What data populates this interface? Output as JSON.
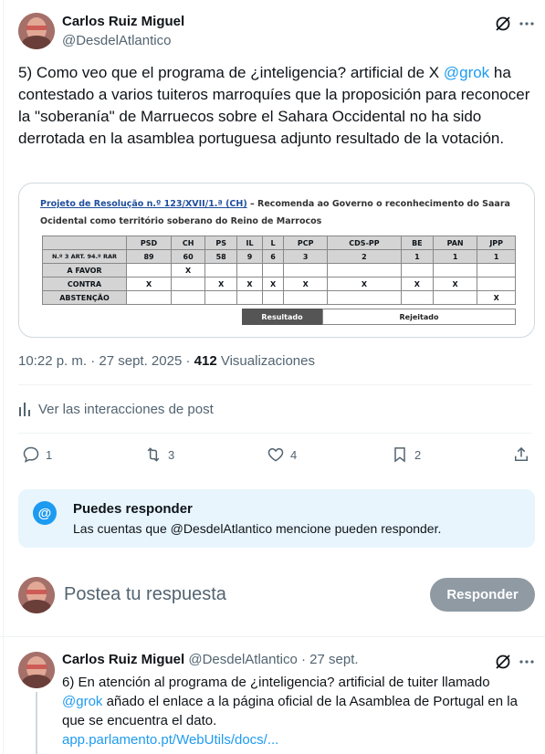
{
  "tweet": {
    "author_name": "Carlos Ruiz Miguel",
    "author_handle": "@DesdelAtlantico",
    "text_before": "5) Como veo que el programa de ¿inteligencia? artificial de X ",
    "text_mention": "@grok",
    "text_after": " ha contestado a varios tuiteros marroquíes que la proposición para reconocer la \"soberanía\" de Marruecos sobre el Sahara Occidental no ha sido derrotada en la asamblea portuguesa adjunto resultado de la votación.",
    "time": "10:22 p. m.",
    "date": "27 sept. 2025",
    "views_count": "412",
    "views_label": "Visualizaciones",
    "interactions_label": "Ver las interacciones de post",
    "replies": "1",
    "retweets": "3",
    "likes": "4",
    "bookmarks": "2"
  },
  "embed": {
    "title_link": "Projeto de Resolução n.º 123/XVII/1.ª (CH)",
    "title_rest": " – Recomenda ao Governo o reconhecimento do Saara",
    "title_line2": "Ocidental como território soberano do Reino de Marrocos",
    "parties": [
      "PSD",
      "CH",
      "PS",
      "IL",
      "L",
      "PCP",
      "CDS-PP",
      "BE",
      "PAN",
      "JPP"
    ],
    "seats_label": "N.º 3 ART. 94.º RAR",
    "seats": [
      "89",
      "60",
      "58",
      "9",
      "6",
      "3",
      "2",
      "1",
      "1",
      "1"
    ],
    "rows": [
      {
        "label": "A FAVOR",
        "marks": [
          "",
          "X",
          "",
          "",
          "",
          "",
          "",
          "",
          "",
          ""
        ]
      },
      {
        "label": "CONTRA",
        "marks": [
          "X",
          "",
          "X",
          "X",
          "X",
          "X",
          "X",
          "X",
          "X",
          ""
        ]
      },
      {
        "label": "ABSTENÇÃO",
        "marks": [
          "",
          "",
          "",
          "",
          "",
          "",
          "",
          "",
          "",
          "X"
        ]
      }
    ],
    "result_label": "Resultado",
    "result_value": "Rejeitado"
  },
  "info": {
    "title": "Puedes responder",
    "text": "Las cuentas que @DesdelAtlantico mencione pueden responder."
  },
  "compose": {
    "placeholder": "Postea tu respuesta",
    "button": "Responder"
  },
  "reply_tweet": {
    "author_name": "Carlos Ruiz Miguel",
    "author_handle": "@DesdelAtlantico",
    "separator": "·",
    "date": "27 sept.",
    "text_line1": "6) En atención al programa de ¿inteligencia? artificial de tuiter llamado",
    "text_mention": "@grok",
    "text_line2_rest": " añado el enlace a la página oficial de la Asamblea de Portugal en la",
    "text_line3": "que se encuentra el dato.",
    "link": "app.parlamento.pt/WebUtils/docs/..."
  }
}
